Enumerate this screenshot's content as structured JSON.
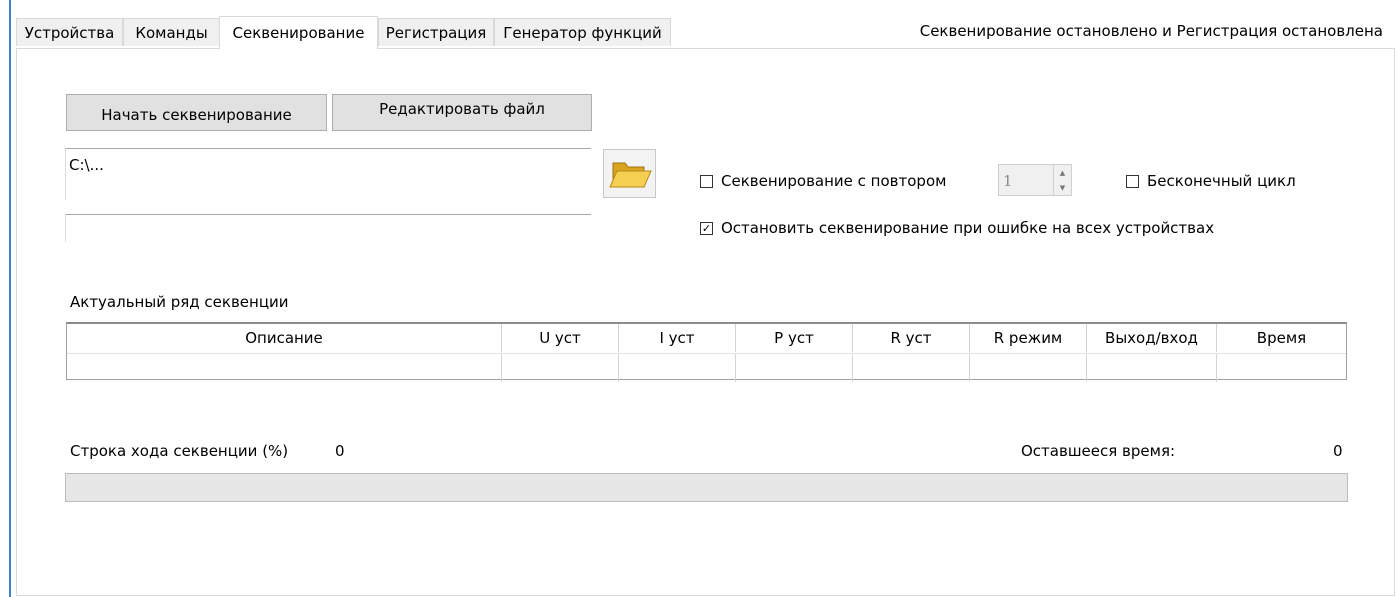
{
  "tabs": [
    {
      "label": "Устройства",
      "active": false
    },
    {
      "label": "Команды",
      "active": false
    },
    {
      "label": "Секвенирование",
      "active": true
    },
    {
      "label": "Регистрация",
      "active": false
    },
    {
      "label": "Генератор функций",
      "active": false
    }
  ],
  "status_text": "Секвенирование остановлено и Регистрация остановлена",
  "buttons": {
    "start": "Начать секвенирование",
    "edit_file": "Редактировать файл"
  },
  "file_path": "C:\\...",
  "file_info": "",
  "options": {
    "repeat_label": "Секвенирование с повтором",
    "repeat_checked": false,
    "repeat_count": "1",
    "infinite_label": "Бесконечный цикл",
    "infinite_checked": false,
    "stop_on_error_label": "Остановить секвенирование при ошибке на всех устройствах",
    "stop_on_error_checked": true
  },
  "current_row_label": "Актуальный ряд секвенции",
  "table": {
    "columns": [
      "Описание",
      "U уст",
      "I уст",
      "P уст",
      "R уст",
      "R режим",
      "Выход/вход",
      "Время"
    ],
    "rows": [
      [
        "",
        "",
        "",
        "",
        "",
        "",
        "",
        ""
      ]
    ]
  },
  "progress": {
    "label": "Строка хода секвенции (%)",
    "value": "0",
    "fraction": 0,
    "remaining_label": "Оставшееся время:",
    "remaining_value": "0"
  },
  "icons": {
    "folder": "folder-open-icon"
  }
}
